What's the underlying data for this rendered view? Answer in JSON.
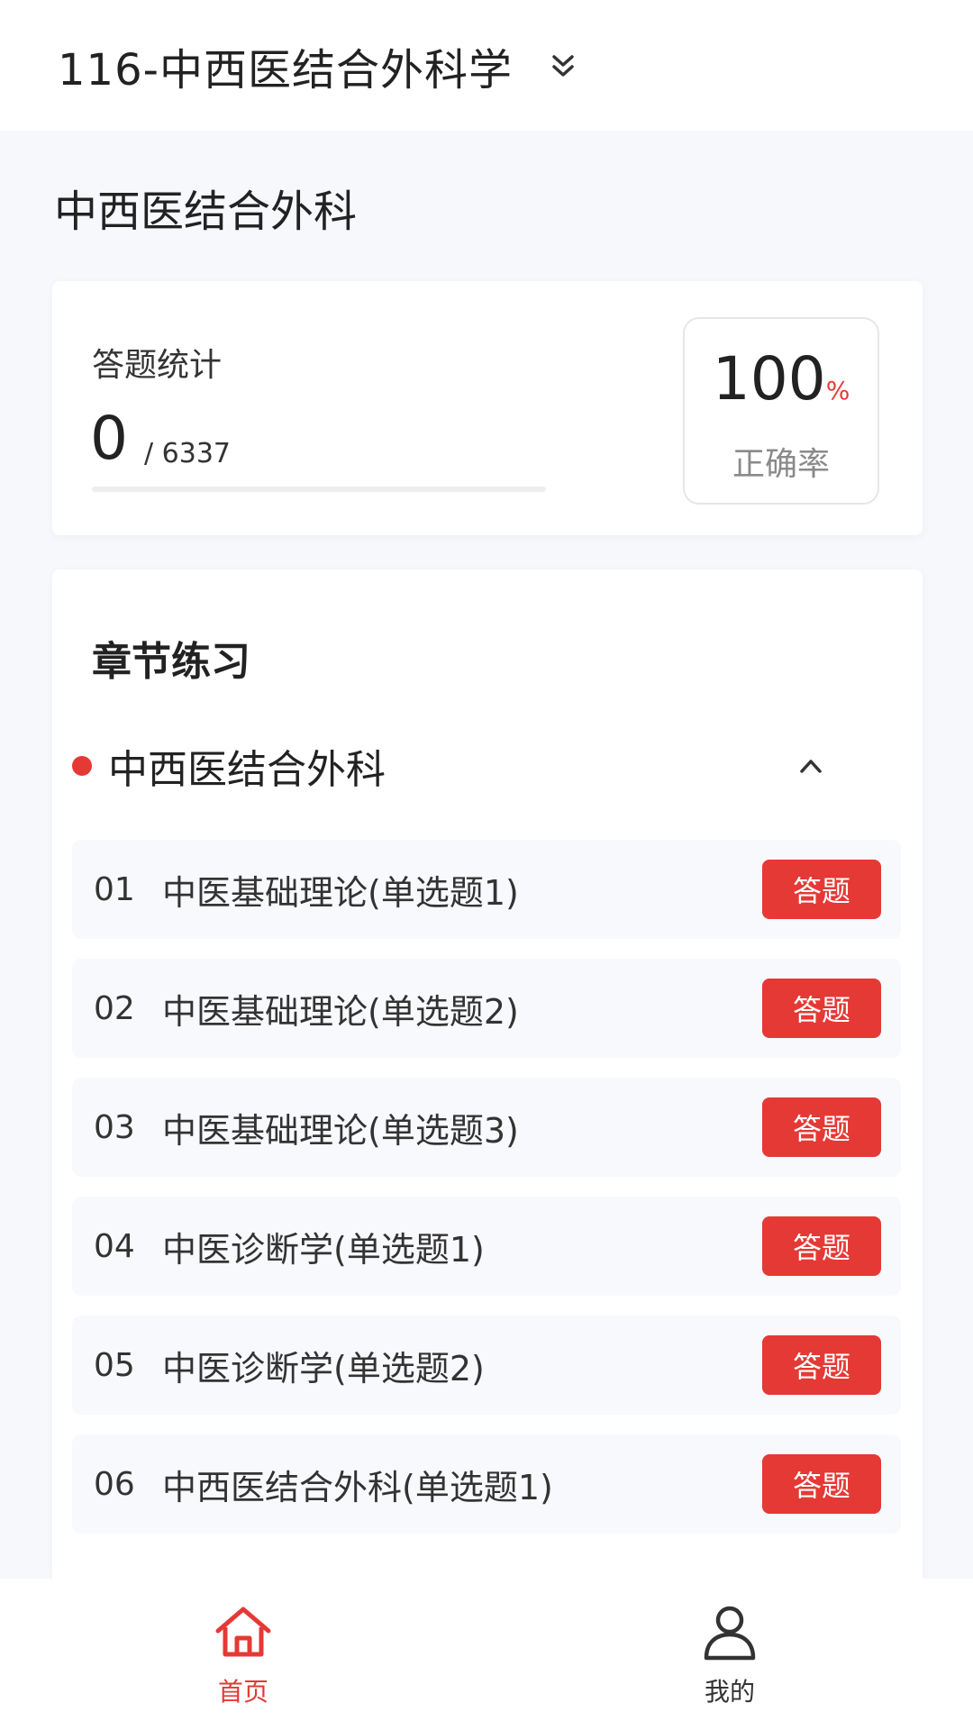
{
  "header": {
    "course_title": "116-中西医结合外科学",
    "dropdown_icon": "double-chevron-down-icon"
  },
  "section_title": "中西医结合外科",
  "stats": {
    "label": "答题统计",
    "answered": "0",
    "total": "/ 6337",
    "progress_fraction": 0,
    "accuracy_value": "100",
    "accuracy_unit": "%",
    "accuracy_label": "正确率"
  },
  "chapter_practice": {
    "heading": "章节练习",
    "group": {
      "name": "中西医结合外科",
      "icon": "chevron-up-icon"
    },
    "items": [
      {
        "num": "01",
        "title": "中医基础理论(单选题1)",
        "button": "答题"
      },
      {
        "num": "02",
        "title": "中医基础理论(单选题2)",
        "button": "答题"
      },
      {
        "num": "03",
        "title": "中医基础理论(单选题3)",
        "button": "答题"
      },
      {
        "num": "04",
        "title": "中医诊断学(单选题1)",
        "button": "答题"
      },
      {
        "num": "05",
        "title": "中医诊断学(单选题2)",
        "button": "答题"
      },
      {
        "num": "06",
        "title": "中西医结合外科(单选题1)",
        "button": "答题"
      }
    ]
  },
  "bottom_nav": [
    {
      "label": "首页",
      "icon": "home-icon",
      "active": true
    },
    {
      "label": "我的",
      "icon": "user-icon",
      "active": false
    }
  ],
  "colors": {
    "accent": "#e53935",
    "background": "#f6f8fc",
    "card": "#ffffff"
  }
}
